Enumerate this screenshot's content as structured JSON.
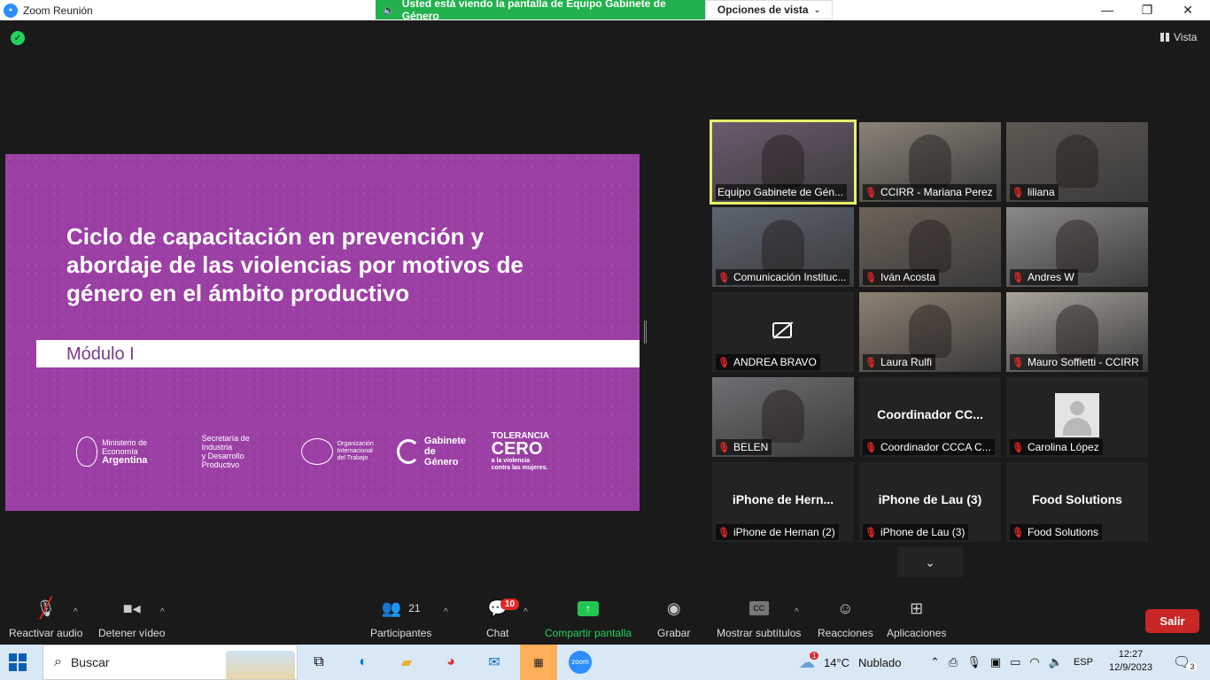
{
  "window": {
    "title": "Zoom Reunión",
    "share_banner": "Usted está viendo la pantalla de Equipo Gabinete de Género",
    "view_options": "Opciones de vista",
    "view_button": "Vista"
  },
  "slide": {
    "title": "Ciclo de capacitación en prevención y abordaje de las violencias por motivos de género en el ámbito productivo",
    "module": "Módulo I",
    "logos": [
      {
        "line1": "Ministerio de Economía",
        "line2": "Argentina"
      },
      {
        "line1": "Secretaría de Industria",
        "line2": "y Desarrollo Productivo"
      },
      {
        "line1": "Organización",
        "line2": "Internacional",
        "line3": "del Trabajo"
      },
      {
        "line1": "Gabinete",
        "line2": "de Género"
      },
      {
        "line1": "TOLERANCIA",
        "line2": "CERO",
        "line3": "a la violencia",
        "line4": "contra las mujeres."
      }
    ]
  },
  "gallery": {
    "tiles": [
      {
        "name": "Equipo Gabinete de Gén...",
        "muted": false,
        "active": true
      },
      {
        "name": "CCIRR - Mariana Perez",
        "muted": true
      },
      {
        "name": "liliana",
        "muted": true
      },
      {
        "name": "Comunicación Instituc...",
        "muted": true
      },
      {
        "name": "Iván Acosta",
        "muted": true
      },
      {
        "name": "Andres W",
        "muted": true
      },
      {
        "name": "ANDREA BRAVO",
        "muted": true,
        "camera_off": true
      },
      {
        "name": "Laura Rulfi",
        "muted": true
      },
      {
        "name": "Mauro Soffietti - CCIRR",
        "muted": true
      },
      {
        "name": "BELEN",
        "muted": true
      },
      {
        "name": "Coordinador CCCA C...",
        "muted": true,
        "display_name": "Coordinador  CC..."
      },
      {
        "name": "Carolina López",
        "muted": true,
        "avatar": true
      },
      {
        "name": "iPhone de Hernan (2)",
        "muted": true,
        "display_name": "iPhone  de  Hern..."
      },
      {
        "name": "iPhone de Lau (3)",
        "muted": true,
        "display_name": "iPhone de Lau (3)"
      },
      {
        "name": "Food Solutions",
        "muted": true,
        "display_name": "Food Solutions"
      }
    ]
  },
  "toolbar": {
    "audio": "Reactivar audio",
    "video": "Detener vídeo",
    "participants": "Participantes",
    "participants_count": "21",
    "chat": "Chat",
    "chat_badge": "10",
    "share": "Compartir pantalla",
    "record": "Grabar",
    "captions": "Mostrar subtítulos",
    "reactions": "Reacciones",
    "apps": "Aplicaciones",
    "leave": "Salir"
  },
  "taskbar": {
    "search": "Buscar",
    "weather_badge": "1",
    "temperature": "14°C",
    "weather": "Nublado",
    "lang": "ESP",
    "time": "12:27",
    "date": "12/9/2023",
    "notif_count": "3"
  },
  "colors": {
    "slide_bg": "#9b3fa5",
    "share_green": "#22b14c",
    "leave_red": "#c92626",
    "active_speaker": "#e6f06a"
  }
}
